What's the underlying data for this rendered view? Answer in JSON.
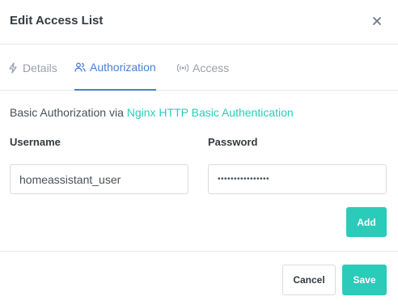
{
  "modal": {
    "title": "Edit Access List"
  },
  "tabs": [
    {
      "label": "Details",
      "icon": "lightning-icon",
      "active": false
    },
    {
      "label": "Authorization",
      "icon": "users-icon",
      "active": true
    },
    {
      "label": "Access",
      "icon": "broadcast-icon",
      "active": false
    }
  ],
  "authorization": {
    "description_prefix": "Basic Authorization via",
    "description_link": "Nginx HTTP Basic Authentication",
    "username_label": "Username",
    "password_label": "Password",
    "username_value": "homeassistant_user",
    "password_value": "••••••••••••••••",
    "add_label": "Add"
  },
  "footer": {
    "cancel_label": "Cancel",
    "save_label": "Save"
  },
  "colors": {
    "accent": "#2bcbba",
    "tab_active": "#467fcf",
    "tab_inactive": "#9aa0ac"
  }
}
